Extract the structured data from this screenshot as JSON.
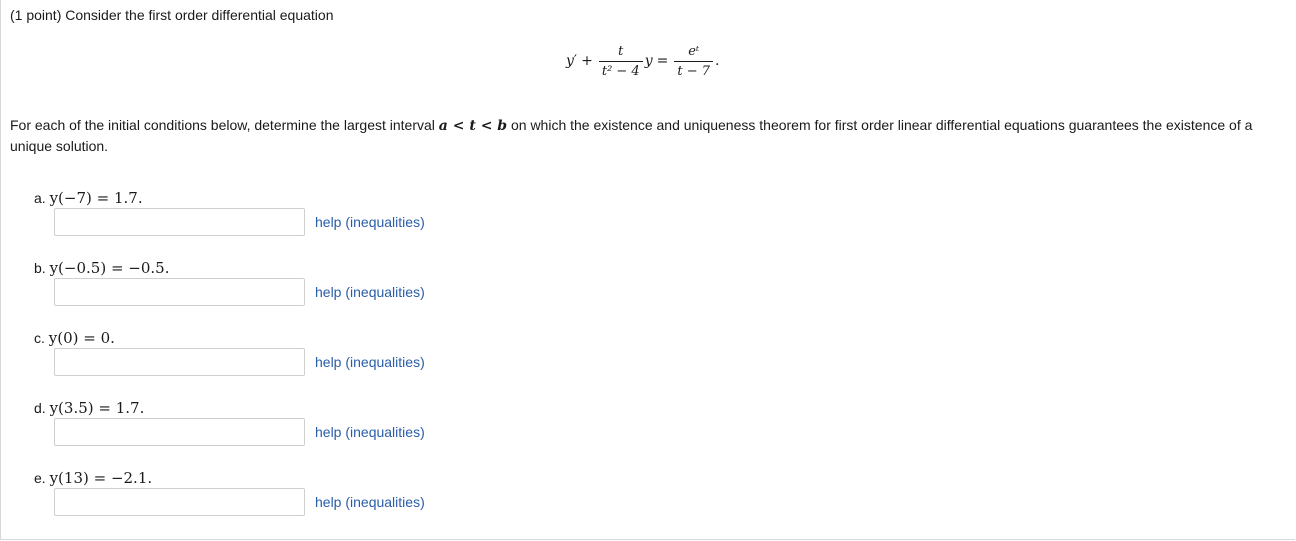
{
  "intro": "(1 point) Consider the first order differential equation",
  "equation": {
    "lhs_y": "y",
    "prime": "′",
    "plus": "+",
    "frac1_num": "t",
    "frac1_den": "t² − 4",
    "y_after": "y",
    "equals": "=",
    "frac2_num": "eᵗ",
    "frac2_den": "t − 7",
    "period": "."
  },
  "description": {
    "before": "For each of the initial conditions below, determine the largest interval ",
    "interval": "a < t < b",
    "after": " on which the existence and uniqueness theorem for first order linear differential equations guarantees the existence of a unique solution."
  },
  "parts": [
    {
      "label": "a.",
      "condition": "y(−7) = 1.7.",
      "answer": "",
      "help": "help (inequalities)"
    },
    {
      "label": "b.",
      "condition": "y(−0.5) = −0.5.",
      "answer": "",
      "help": "help (inequalities)"
    },
    {
      "label": "c.",
      "condition": "y(0) = 0.",
      "answer": "",
      "help": "help (inequalities)"
    },
    {
      "label": "d.",
      "condition": "y(3.5) = 1.7.",
      "answer": "",
      "help": "help (inequalities)"
    },
    {
      "label": "e.",
      "condition": "y(13) = −2.1.",
      "answer": "",
      "help": "help (inequalities)"
    }
  ],
  "colors": {
    "link": "#2a5da8",
    "input_border": "#cfcfcf"
  }
}
